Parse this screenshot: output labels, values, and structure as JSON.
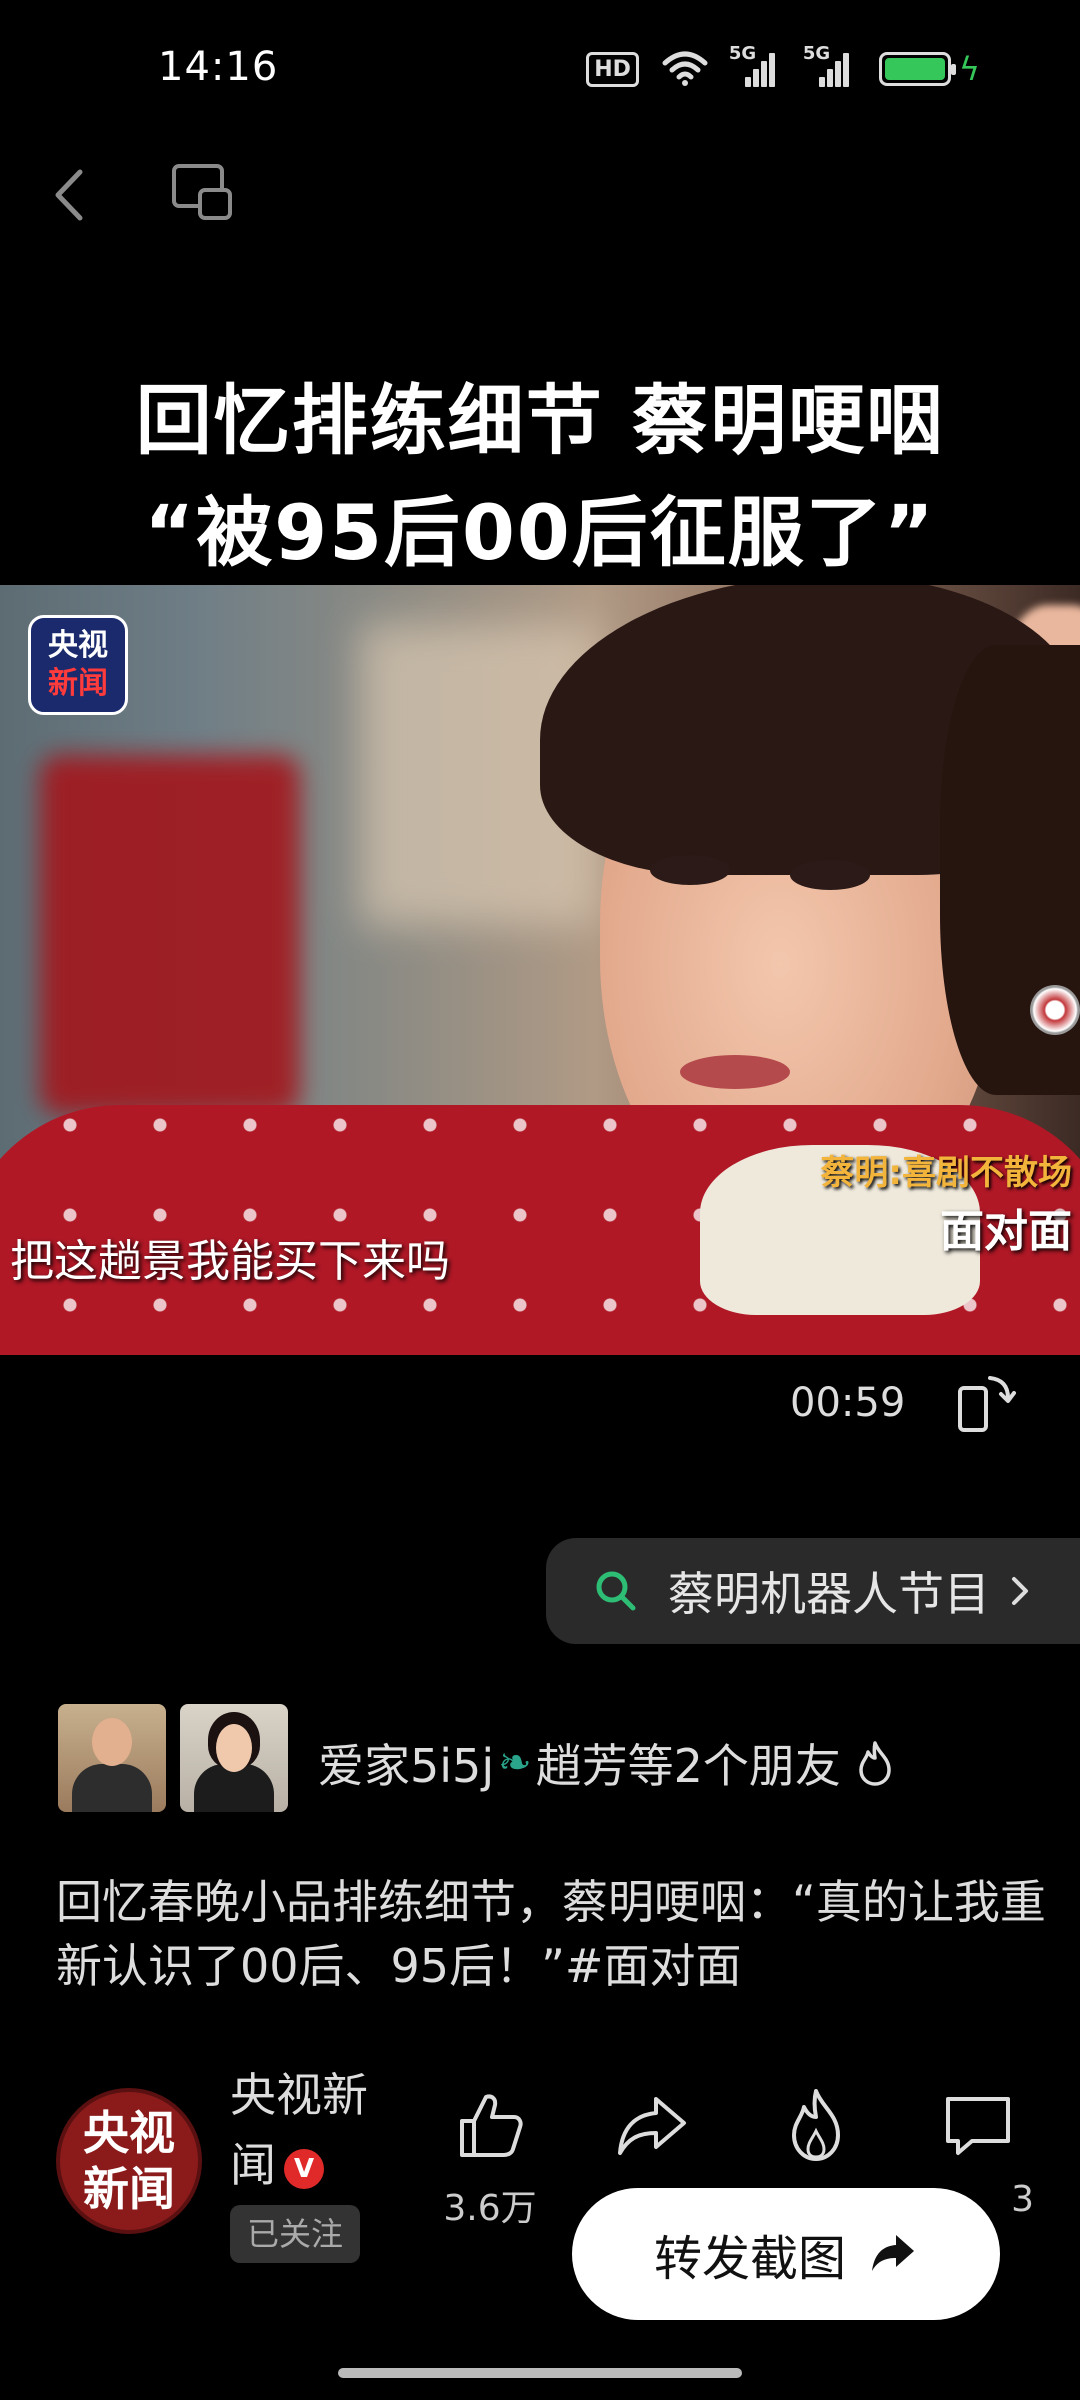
{
  "status_bar": {
    "time": "14:16",
    "hd_label": "HD",
    "signal1_label": "5G",
    "signal2_label": "5G",
    "battery_color": "#35c759"
  },
  "nav": {
    "back_icon": "chevron-left-icon",
    "float_icon": "float-window-icon"
  },
  "video": {
    "title_line1": "回忆排练细节 蔡明哽咽",
    "title_line2": "“被95后00后征服了”",
    "logo_line1": "央视",
    "logo_line2": "新闻",
    "show_name": "蔡明:喜剧不散场",
    "show_sub": "面对面",
    "subtitle": "把这趟景我能买下来吗",
    "duration": "00:59"
  },
  "search_chip": {
    "label": "蔡明机器人节目",
    "icon": "search-icon",
    "accent": "#2ebd75"
  },
  "friends": {
    "text_before": "爱家5i5j",
    "text_after": "趙芳等2个朋友",
    "icon": "flame-icon"
  },
  "caption": "回忆春晚小品排练细节，蔡明哽咽：“真的让我重新认识了00后、95后！”#面对面",
  "author": {
    "avatar_line1": "央视",
    "avatar_line2": "新闻",
    "name": "央视新闻",
    "verified": "V",
    "follow_label": "已关注"
  },
  "actions": {
    "like_count": "3.6万",
    "comment_count_partial": "3"
  },
  "screenshot_button": {
    "label": "转发截图"
  }
}
